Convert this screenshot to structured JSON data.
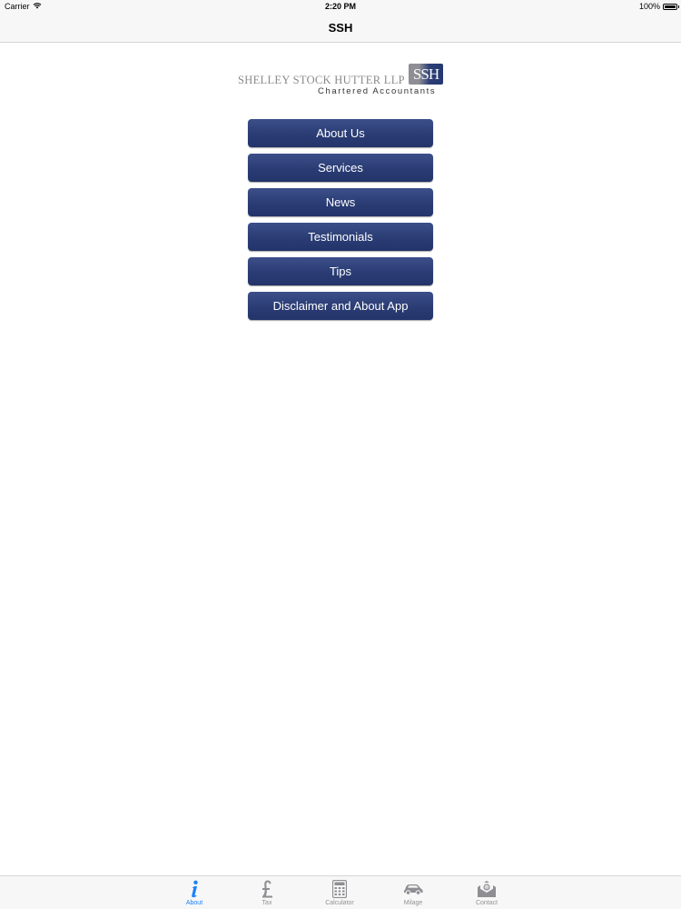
{
  "status_bar": {
    "carrier": "Carrier",
    "time": "2:20 PM",
    "battery": "100%",
    "battery_level": 1.0
  },
  "nav": {
    "title": "SSH"
  },
  "logo": {
    "firm_name": "SHELLEY STOCK HUTTER LLP",
    "badge": "SSH",
    "tagline": "Chartered Accountants"
  },
  "menu": {
    "items": [
      {
        "label": "About Us"
      },
      {
        "label": "Services"
      },
      {
        "label": "News"
      },
      {
        "label": "Testimonials"
      },
      {
        "label": "Tips"
      },
      {
        "label": "Disclaimer and About App"
      }
    ]
  },
  "tab_bar": {
    "active": "About",
    "active_color": "#1a82fb",
    "inactive_color": "#929292",
    "tabs": [
      {
        "label": "About",
        "icon": "info-icon"
      },
      {
        "label": "Tax",
        "icon": "pound-icon"
      },
      {
        "label": "Calculator",
        "icon": "calculator-icon"
      },
      {
        "label": "Milage",
        "icon": "car-icon"
      },
      {
        "label": "Contact",
        "icon": "envelope-icon"
      }
    ]
  },
  "colors": {
    "button": "#2a3c73",
    "bar_background": "#f7f7f7"
  }
}
